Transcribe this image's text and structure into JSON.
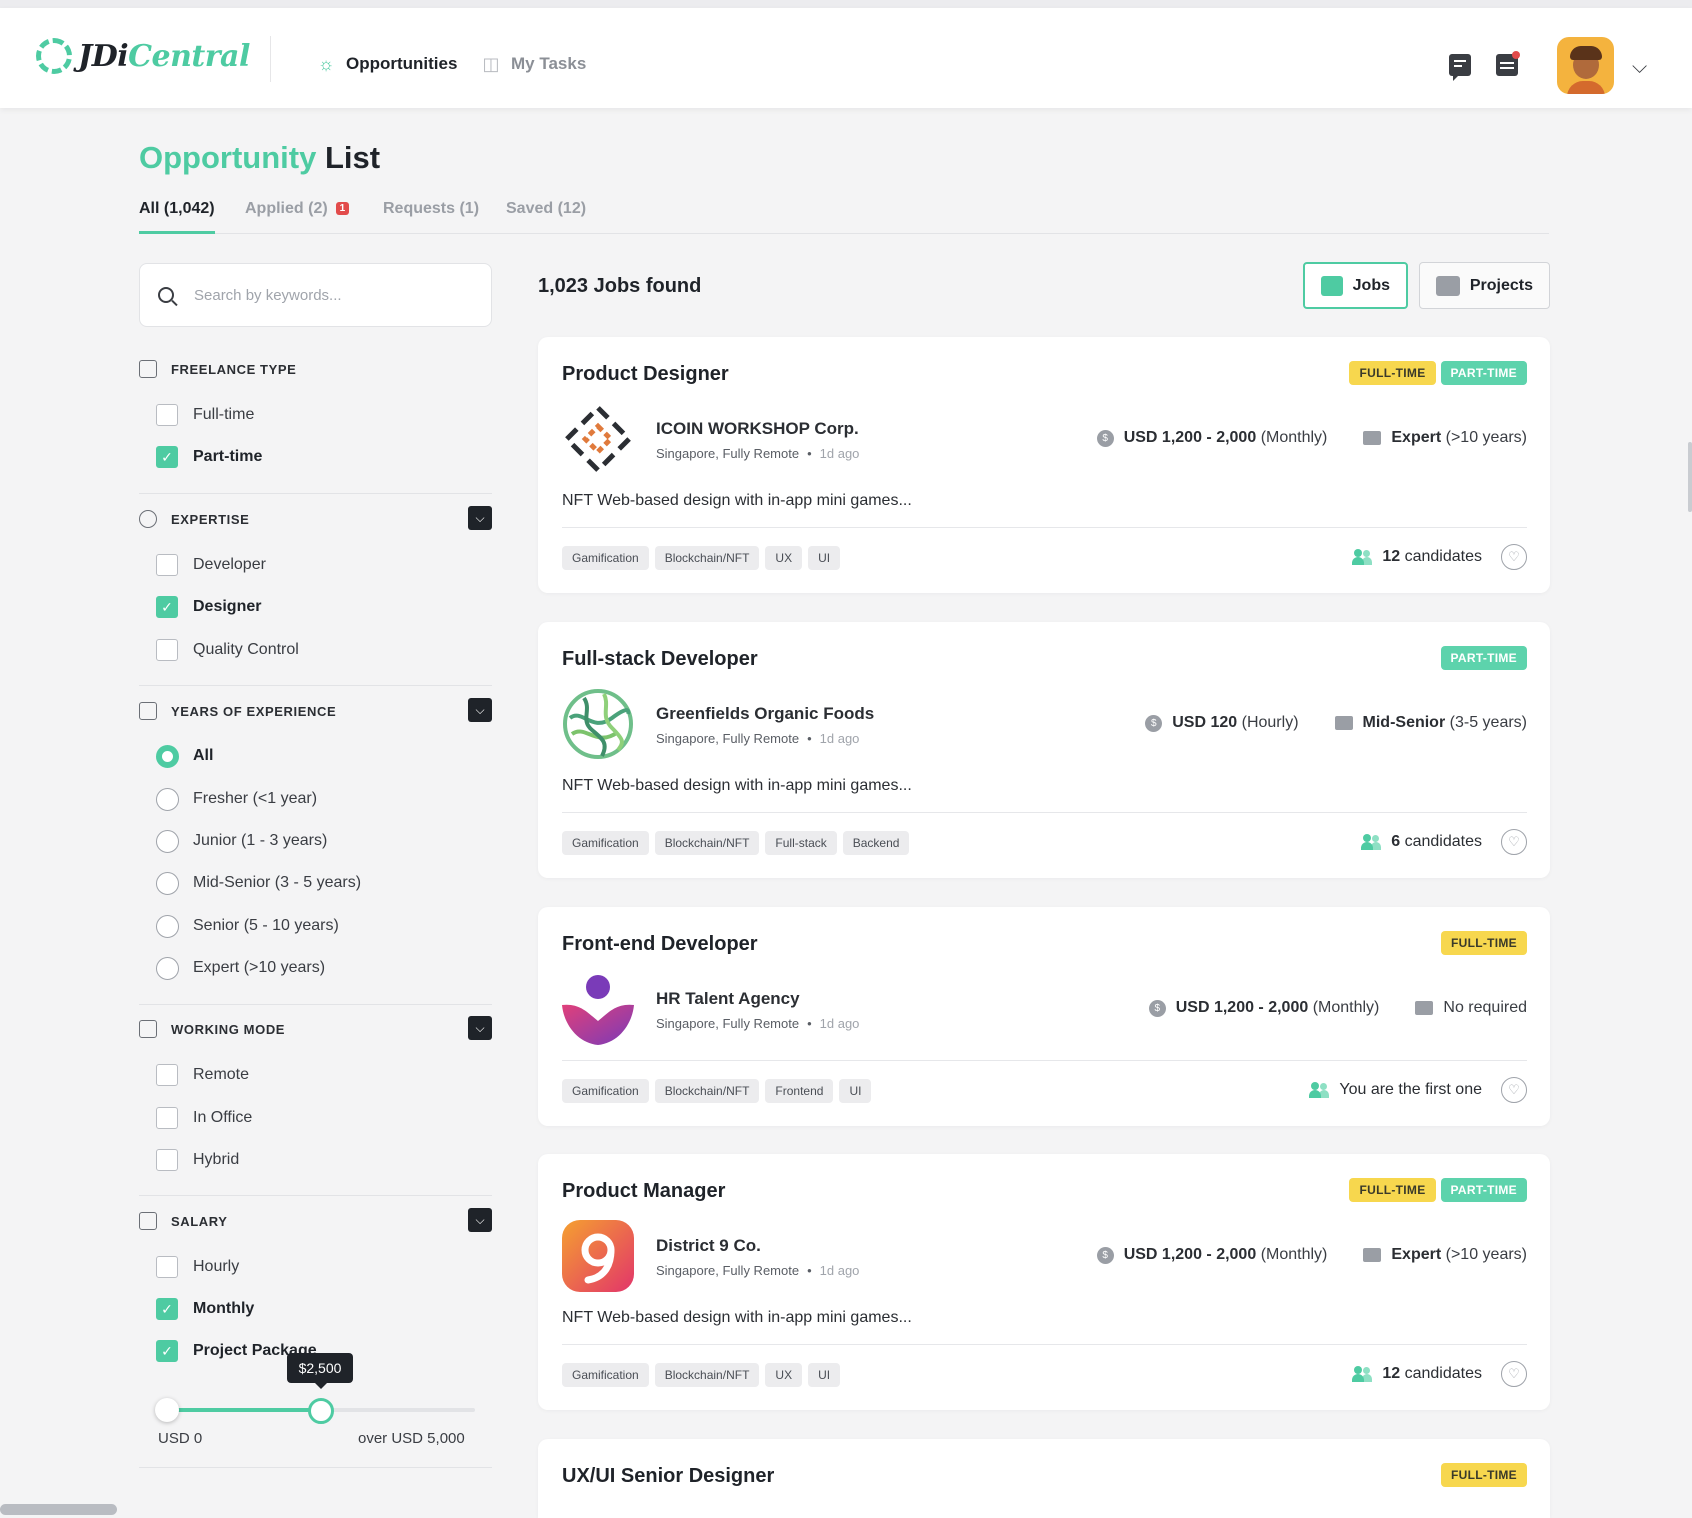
{
  "app": {
    "logo_jdi": "JDi",
    "logo_central": "Central"
  },
  "nav": {
    "opportunities": "Opportunities",
    "my_tasks": "My Tasks"
  },
  "page": {
    "title_accent": "Opportunity",
    "title_rest": "List"
  },
  "tabs": [
    {
      "label": "All (1,042)",
      "active": true
    },
    {
      "label": "Applied (2)",
      "badge": "1"
    },
    {
      "label": "Requests (1)"
    },
    {
      "label": "Saved (12)"
    }
  ],
  "search": {
    "placeholder": "Search by keywords...",
    "value": ""
  },
  "filters": {
    "freelance_type": {
      "title": "FREELANCE TYPE",
      "options": [
        {
          "label": "Full-time",
          "checked": false
        },
        {
          "label": "Part-time",
          "checked": true
        }
      ]
    },
    "expertise": {
      "title": "EXPERTISE",
      "options": [
        {
          "label": "Developer",
          "checked": false
        },
        {
          "label": "Designer",
          "checked": true
        },
        {
          "label": "Quality Control",
          "checked": false
        }
      ]
    },
    "experience": {
      "title": "YEARS OF EXPERIENCE",
      "options": [
        {
          "label": "All",
          "selected": true
        },
        {
          "label": "Fresher (<1 year)"
        },
        {
          "label": "Junior (1 - 3 years)"
        },
        {
          "label": "Mid-Senior (3 - 5 years)"
        },
        {
          "label": "Senior (5 - 10 years)"
        },
        {
          "label": "Expert (>10 years)"
        }
      ]
    },
    "working_mode": {
      "title": "WORKING MODE",
      "options": [
        {
          "label": "Remote",
          "checked": false
        },
        {
          "label": "In Office",
          "checked": false
        },
        {
          "label": "Hybrid",
          "checked": false
        }
      ]
    },
    "salary": {
      "title": "SALARY",
      "options": [
        {
          "label": "Hourly",
          "checked": false
        },
        {
          "label": "Monthly",
          "checked": true
        },
        {
          "label": "Project Package",
          "checked": true
        }
      ],
      "slider": {
        "tooltip": "$2,500",
        "min_label": "USD 0",
        "max_label": "over USD 5,000",
        "value": 2500,
        "max": 5000
      }
    }
  },
  "results": {
    "count_label": "1,023 Jobs found",
    "view_jobs": "Jobs",
    "view_projects": "Projects"
  },
  "jobs": [
    {
      "title": "Product Designer",
      "badges": [
        "FULL-TIME",
        "PART-TIME"
      ],
      "company": "ICOIN WORKSHOP Corp.",
      "location": "Singapore, Fully Remote",
      "posted": "1d ago",
      "salary_bold": "USD 1,200 - 2,000",
      "salary_unit": "(Monthly)",
      "level_bold": "Expert",
      "level_detail": "(>10 years)",
      "description": "NFT Web-based design with in-app mini games...",
      "tags": [
        "Gamification",
        "Blockchain/NFT",
        "UX",
        "UI"
      ],
      "candidates_bold": "12",
      "candidates_text": "candidates"
    },
    {
      "title": "Full-stack Developer",
      "badges": [
        "PART-TIME"
      ],
      "company": "Greenfields Organic Foods",
      "location": "Singapore, Fully Remote",
      "posted": "1d ago",
      "salary_bold": "USD 120",
      "salary_unit": "(Hourly)",
      "level_bold": "Mid-Senior",
      "level_detail": "(3-5 years)",
      "description": "NFT Web-based design with in-app mini games...",
      "tags": [
        "Gamification",
        "Blockchain/NFT",
        "Full-stack",
        "Backend"
      ],
      "candidates_bold": "6",
      "candidates_text": "candidates"
    },
    {
      "title": "Front-end Developer",
      "badges": [
        "FULL-TIME"
      ],
      "company": "HR Talent Agency",
      "location": "Singapore, Fully Remote",
      "posted": "1d ago",
      "salary_bold": "USD 1,200 - 2,000",
      "salary_unit": "(Monthly)",
      "level_bold": "",
      "level_detail": "No required",
      "description": "",
      "tags": [
        "Gamification",
        "Blockchain/NFT",
        "Frontend",
        "UI"
      ],
      "candidates_bold": "",
      "candidates_text": "You are the first one"
    },
    {
      "title": "Product Manager",
      "badges": [
        "FULL-TIME",
        "PART-TIME"
      ],
      "company": "District 9 Co.",
      "location": "Singapore, Fully Remote",
      "posted": "1d ago",
      "salary_bold": "USD 1,200 - 2,000",
      "salary_unit": "(Monthly)",
      "level_bold": "Expert",
      "level_detail": "(>10 years)",
      "description": "NFT Web-based design with in-app mini games...",
      "tags": [
        "Gamification",
        "Blockchain/NFT",
        "UX",
        "UI"
      ],
      "candidates_bold": "12",
      "candidates_text": "candidates"
    },
    {
      "title": "UX/UI Senior Designer",
      "badges": [
        "FULL-TIME"
      ]
    }
  ],
  "colors": {
    "accent": "#4ecba2",
    "full_time_badge": "#f7d74e",
    "part_time_badge": "#5dd3ac",
    "notification": "#e24b4b"
  },
  "icons": {
    "opportunities": "lightbulb-icon",
    "tasks": "board-icon",
    "chat": "chat-icon",
    "calendar": "calendar-icon",
    "account_menu": "chevron-down-icon",
    "save_job": "heart-icon"
  }
}
